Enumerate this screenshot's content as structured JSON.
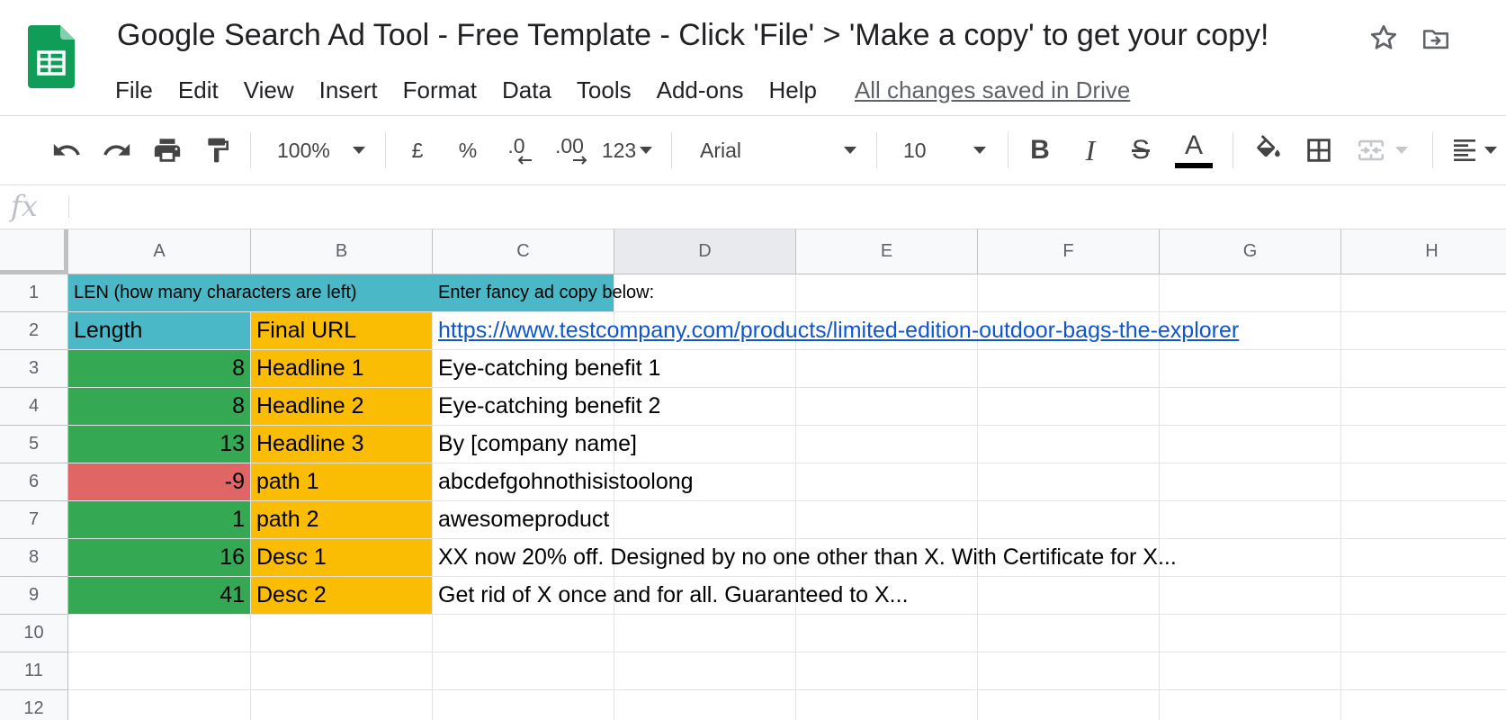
{
  "doc": {
    "title": "Google Search Ad Tool - Free Template - Click 'File' > 'Make a copy' to get your copy!",
    "save_status": "All changes saved in Drive"
  },
  "menu": [
    "File",
    "Edit",
    "View",
    "Insert",
    "Format",
    "Data",
    "Tools",
    "Add-ons",
    "Help"
  ],
  "toolbar": {
    "zoom": "100%",
    "currency": "£",
    "percent": "%",
    "decrease_decimals": ".0",
    "increase_decimals": ".00",
    "more_formats": "123",
    "font": "Arial",
    "font_size": "10",
    "bold": "B",
    "italic": "I",
    "strikethrough": "S",
    "text_color": "A",
    "text_color_swatch": "#000000"
  },
  "formula_bar": {
    "fx": "fx",
    "value": ""
  },
  "columns": [
    "A",
    "B",
    "C",
    "D",
    "E",
    "F",
    "G",
    "H"
  ],
  "selected_column": "D",
  "rows": [
    "1",
    "2",
    "3",
    "4",
    "5",
    "6",
    "7",
    "8",
    "9",
    "10",
    "11",
    "12"
  ],
  "colors": {
    "teal": "#4ab8c7",
    "green": "#34a853",
    "red": "#e06666",
    "orange": "#fbbc04",
    "link": "#1155cc",
    "sheets_green": "#0f9d58"
  },
  "cells": {
    "A1": "LEN (how many characters are left)",
    "C1": "Enter fancy ad copy below:",
    "A2": "Length",
    "B2": "Final URL",
    "C2": "https://www.testcompany.com/products/limited-edition-outdoor-bags-the-explorer",
    "A3": "8",
    "B3": "Headline 1",
    "C3": "Eye-catching benefit 1",
    "A4": "8",
    "B4": "Headline 2",
    "C4": "Eye-catching benefit 2",
    "A5": "13",
    "B5": "Headline 3",
    "C5": "By [company name]",
    "A6": "-9",
    "B6": "path 1",
    "C6": "abcdefgohnothisistoolong",
    "A7": "1",
    "B7": "path 2",
    "C7": "awesomeproduct",
    "A8": "16",
    "B8": "Desc 1",
    "C8": "XX now 20% off. Designed by no one other than X. With Certificate for X...",
    "A9": "41",
    "B9": "Desc 2",
    "C9": "Get rid of X once and for all. Guaranteed to X..."
  }
}
